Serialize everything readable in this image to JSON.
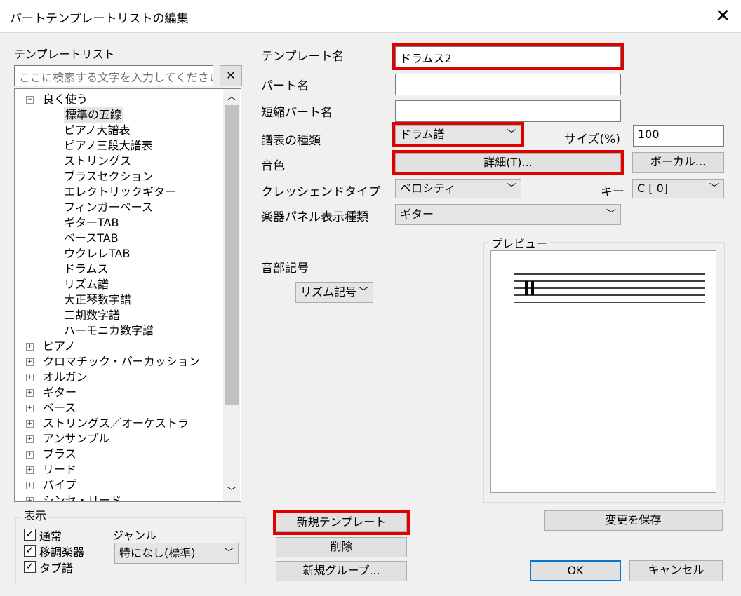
{
  "window": {
    "title": "パートテンプレートリストの編集",
    "close_glyph": "✕"
  },
  "left": {
    "list_label": "テンプレートリスト",
    "search_placeholder": "ここに検索する文字を入力してください",
    "search_clear": "✕",
    "tree": [
      {
        "label": "良く使う",
        "expanded": true,
        "children": [
          "標準の五線",
          "ピアノ大譜表",
          "ピアノ三段大譜表",
          "ストリングス",
          "ブラスセクション",
          "エレクトリックギター",
          "フィンガーベース",
          "ギターTAB",
          "ベースTAB",
          "ウクレレTAB",
          "ドラムス",
          "リズム譜",
          "大正琴数字譜",
          "二胡数字譜",
          "ハーモニカ数字譜"
        ]
      },
      {
        "label": "ピアノ"
      },
      {
        "label": "クロマチック・パーカッション"
      },
      {
        "label": "オルガン"
      },
      {
        "label": "ギター"
      },
      {
        "label": "ベース"
      },
      {
        "label": "ストリングス／オーケストラ"
      },
      {
        "label": "アンサンブル"
      },
      {
        "label": "ブラス"
      },
      {
        "label": "リード"
      },
      {
        "label": "パイプ"
      },
      {
        "label": "シンセ・リード"
      }
    ],
    "display_group": {
      "label": "表示",
      "checks": [
        {
          "label": "通常",
          "checked": true
        },
        {
          "label": "移調楽器",
          "checked": true
        },
        {
          "label": "タブ譜",
          "checked": true
        }
      ],
      "genre_label": "ジャンル",
      "genre_value": "特になし(標準)"
    }
  },
  "form": {
    "template_name_label": "テンプレート名",
    "template_name_value": "ドラムス2",
    "part_name_label": "パート名",
    "part_name_value": "",
    "short_name_label": "短縮パート名",
    "short_name_value": "",
    "staff_type_label": "譜表の種類",
    "staff_type_value": "ドラム譜",
    "size_label": "サイズ(%)",
    "size_value": "100",
    "tone_label": "音色",
    "detail_button": "詳細(T)...",
    "vocal_button": "ボーカル...",
    "crescendo_label": "クレッシェンドタイプ",
    "crescendo_value": "ベロシティ",
    "key_label": "キー",
    "key_value": "C [ 0]",
    "panel_label": "楽器パネル表示種類",
    "panel_value": "ギター",
    "clef_label": "音部記号",
    "clef_value": "リズム記号",
    "preview_label": "プレビュー"
  },
  "buttons": {
    "new_template": "新規テンプレート",
    "delete": "削除",
    "new_group": "新規グループ...",
    "save_changes": "変更を保存",
    "ok": "OK",
    "cancel": "キャンセル"
  },
  "icons": {
    "combo_arrow": "chevron-down-icon",
    "scroll_up": "chevron-up-icon",
    "scroll_down": "chevron-down-icon"
  },
  "colors": {
    "highlight_red": "#e00000"
  }
}
